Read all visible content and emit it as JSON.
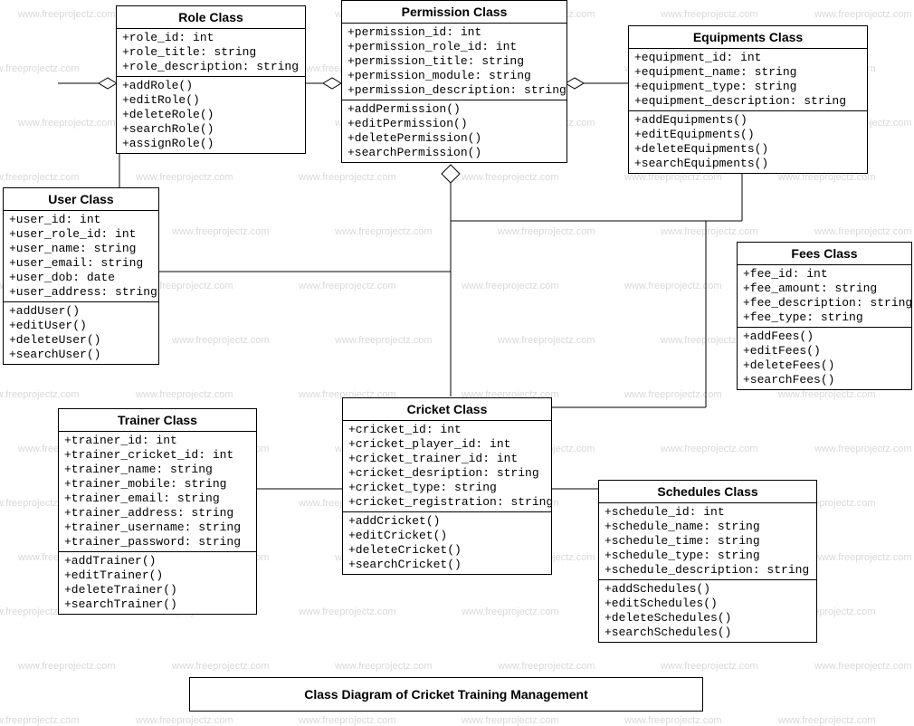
{
  "watermark_text": "www.freeprojectz.com",
  "caption": "Class Diagram of Cricket Training Management",
  "classes": {
    "role": {
      "title": "Role Class",
      "attrs": [
        "+role_id: int",
        "+role_title: string",
        "+role_description: string"
      ],
      "ops": [
        "+addRole()",
        "+editRole()",
        "+deleteRole()",
        "+searchRole()",
        "+assignRole()"
      ]
    },
    "permission": {
      "title": "Permission Class",
      "attrs": [
        "+permission_id: int",
        "+permission_role_id: int",
        "+permission_title: string",
        "+permission_module: string",
        "+permission_description: string"
      ],
      "ops": [
        "+addPermission()",
        "+editPermission()",
        "+deletePermission()",
        "+searchPermission()"
      ]
    },
    "equipments": {
      "title": "Equipments Class",
      "attrs": [
        "+equipment_id: int",
        "+equipment_name: string",
        "+equipment_type: string",
        "+equipment_description: string"
      ],
      "ops": [
        "+addEquipments()",
        "+editEquipments()",
        "+deleteEquipments()",
        "+searchEquipments()"
      ]
    },
    "user": {
      "title": "User Class",
      "attrs": [
        "+user_id: int",
        "+user_role_id: int",
        "+user_name: string",
        "+user_email: string",
        "+user_dob: date",
        "+user_address: string"
      ],
      "ops": [
        "+addUser()",
        "+editUser()",
        "+deleteUser()",
        "+searchUser()"
      ]
    },
    "fees": {
      "title": "Fees Class",
      "attrs": [
        "+fee_id: int",
        "+fee_amount: string",
        "+fee_description: string",
        "+fee_type: string"
      ],
      "ops": [
        "+addFees()",
        "+editFees()",
        "+deleteFees()",
        "+searchFees()"
      ]
    },
    "trainer": {
      "title": "Trainer Class",
      "attrs": [
        "+trainer_id: int",
        "+trainer_cricket_id: int",
        "+trainer_name: string",
        "+trainer_mobile: string",
        "+trainer_email: string",
        "+trainer_address: string",
        "+trainer_username: string",
        "+trainer_password: string"
      ],
      "ops": [
        "+addTrainer()",
        "+editTrainer()",
        "+deleteTrainer()",
        "+searchTrainer()"
      ]
    },
    "cricket": {
      "title": "Cricket Class",
      "attrs": [
        "+cricket_id: int",
        "+cricket_player_id: int",
        "+cricket_trainer_id: int",
        "+cricket_desription: string",
        "+cricket_type: string",
        "+cricket_registration: string"
      ],
      "ops": [
        "+addCricket()",
        "+editCricket()",
        "+deleteCricket()",
        "+searchCricket()"
      ]
    },
    "schedules": {
      "title": "Schedules Class",
      "attrs": [
        "+schedule_id: int",
        "+schedule_name: string",
        "+schedule_time: string",
        "+schedule_type: string",
        "+schedule_description: string"
      ],
      "ops": [
        "+addSchedules()",
        "+editSchedules()",
        "+deleteSchedules()",
        "+searchSchedules()"
      ]
    }
  }
}
